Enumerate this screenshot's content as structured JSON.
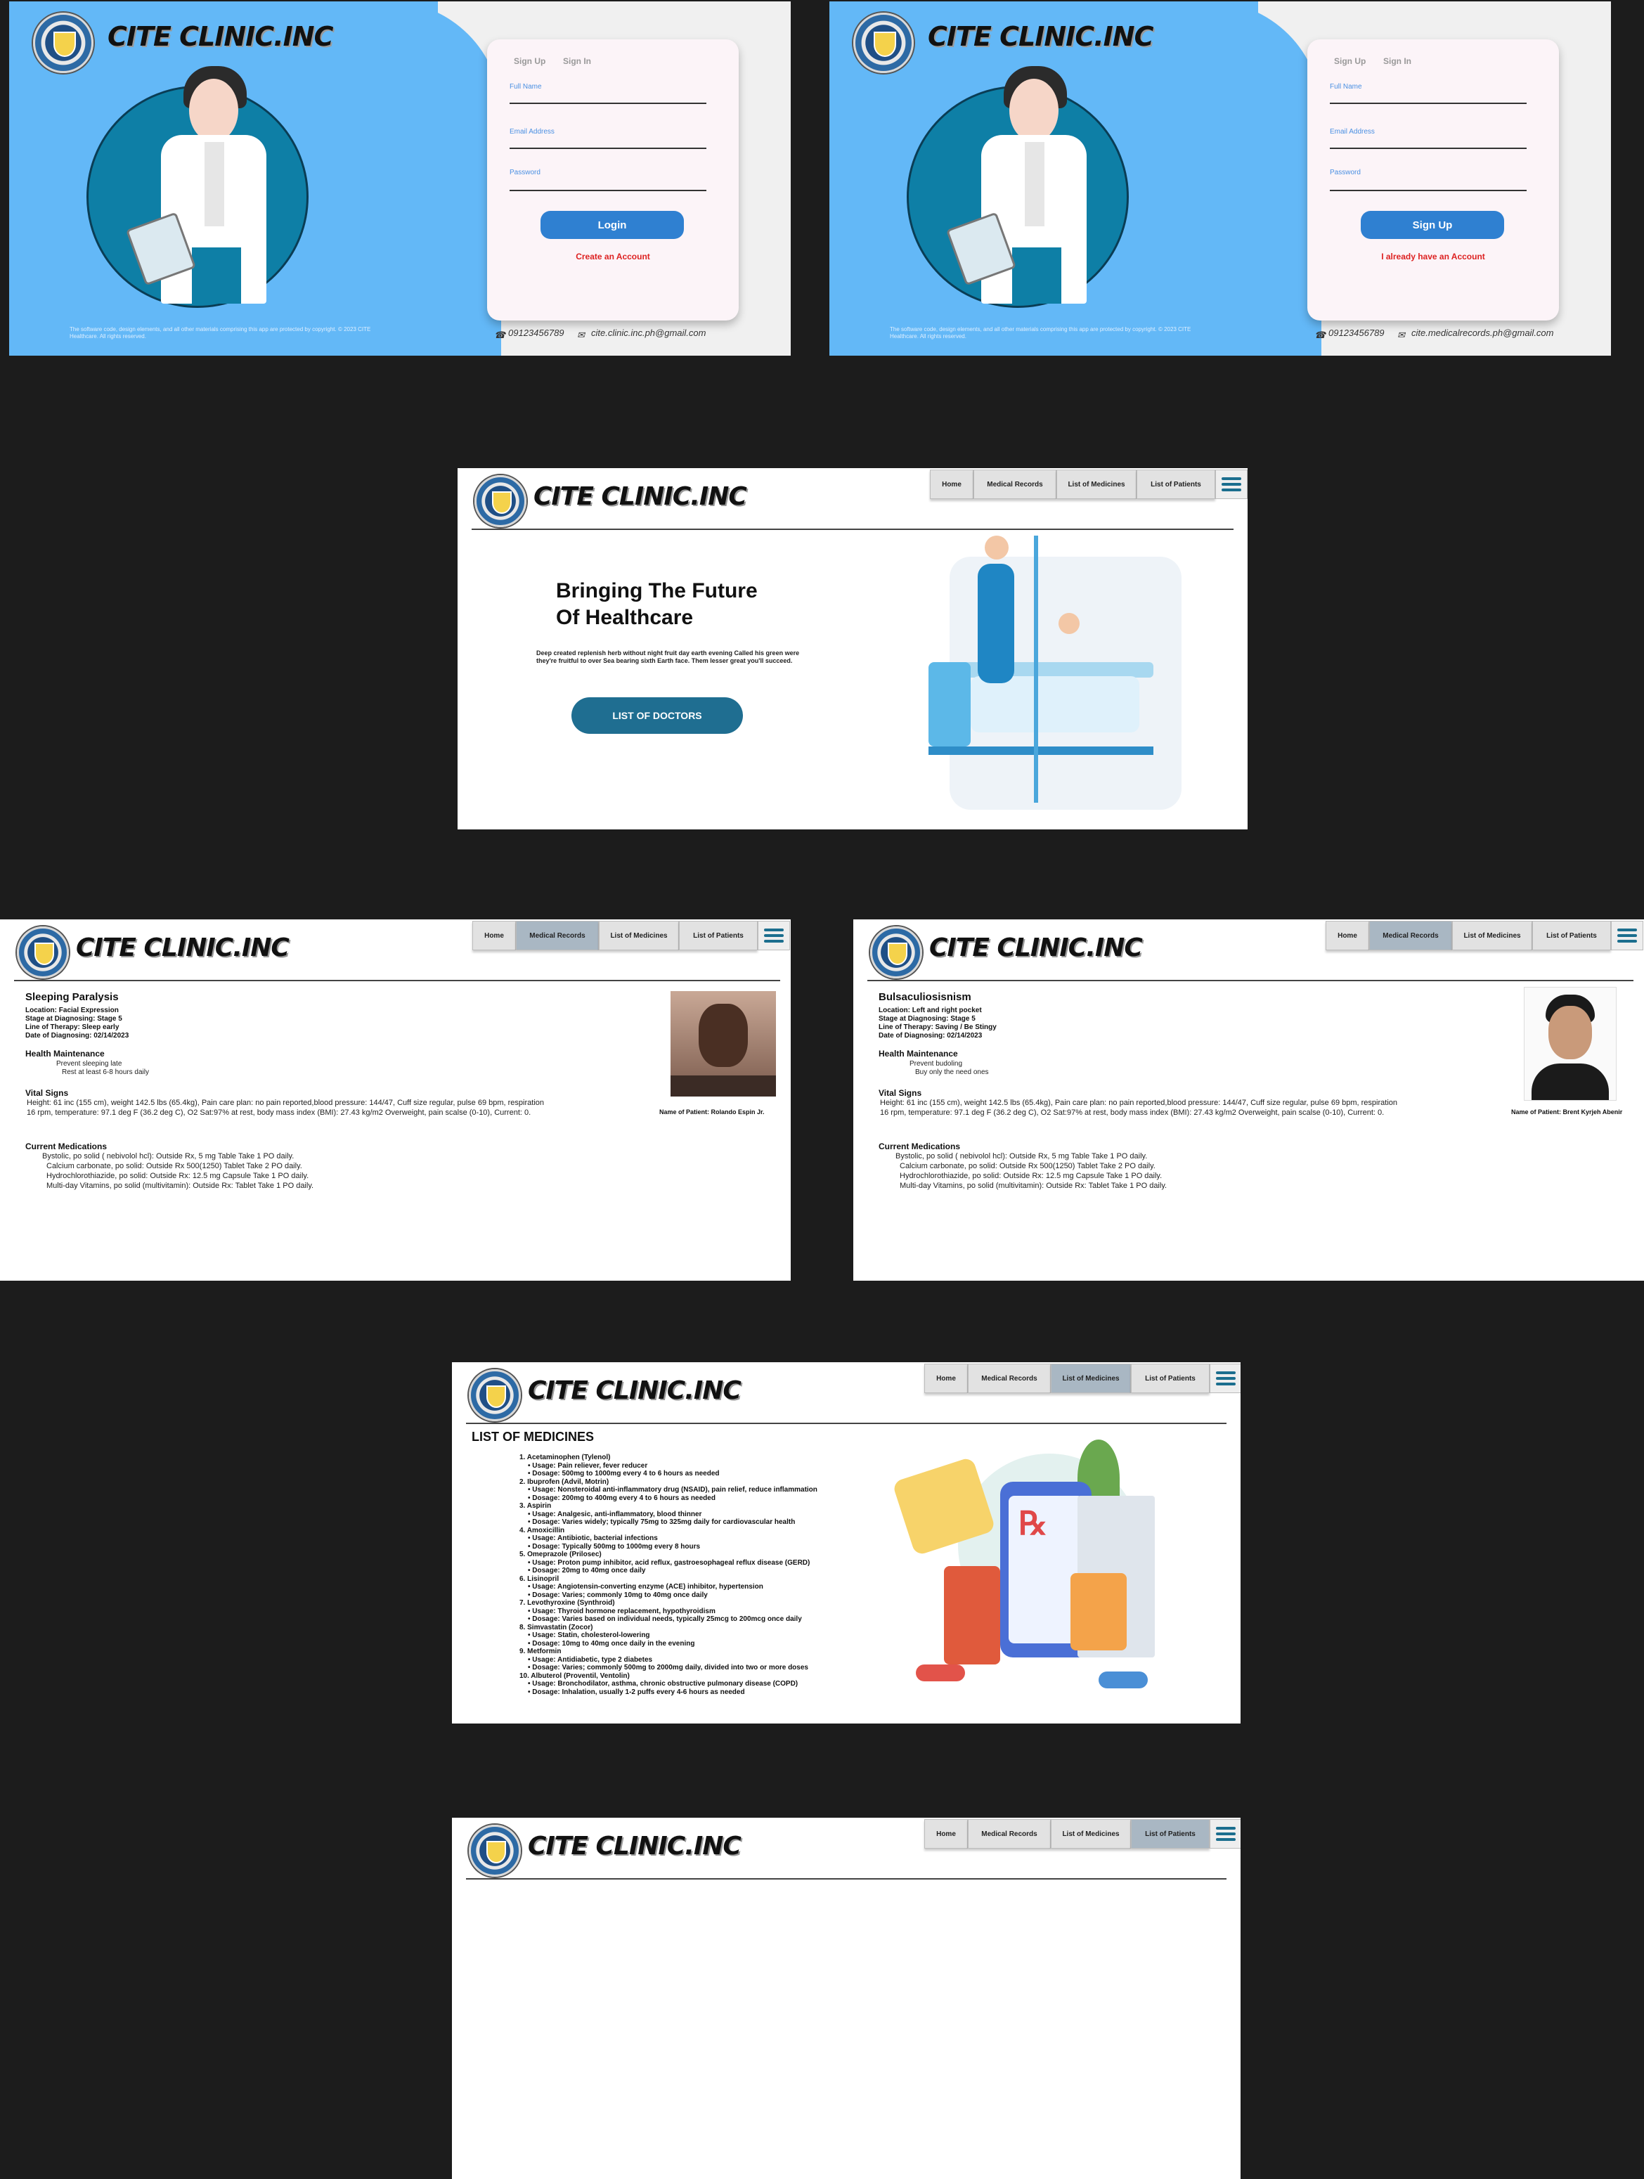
{
  "brand": "CITE CLINIC.INC",
  "nav": {
    "home": "Home",
    "records": "Medical Records",
    "medicines": "List of Medicines",
    "patients": "List of Patients"
  },
  "login1": {
    "tab_signup": "Sign Up",
    "tab_signin": "Sign In",
    "full_name": "Full Name",
    "email": "Email Address",
    "password": "Password",
    "button": "Login",
    "link": "Create an Account",
    "copyright": "The software code, design elements, and all other materials comprising this app are protected by copyright. © 2023 CITE Healthcare. All rights reserved.",
    "phone": "09123456789",
    "mail": "cite.clinic.inc.ph@gmail.com"
  },
  "login2": {
    "tab_signup": "Sign Up",
    "tab_signin": "Sign In",
    "full_name": "Full Name",
    "email": "Email Address",
    "password": "Password",
    "button": "Sign Up",
    "link": "I already have an Account",
    "copyright": "The software code, design elements, and all other materials comprising this app are protected by copyright. © 2023 CITE Healthcare. All rights reserved.",
    "phone": "09123456789",
    "mail": "cite.medicalrecords.ph@gmail.com"
  },
  "home": {
    "headline1": "Bringing The Future",
    "headline2": "Of Healthcare",
    "body": "Deep created replenish herb without night fruit day earth evening Called his green were they're fruitful to over Sea bearing sixth Earth face. Them lesser great you'll succeed.",
    "button": "LIST OF DOCTORS"
  },
  "record1": {
    "title": "Sleeping Paralysis",
    "location": "Location: Facial Expression",
    "stage": "Stage at Diagnosing: Stage 5",
    "therapy": "Line of Therapy: Sleep early",
    "date": "Date of Diagnosing: 02/14/2023",
    "hm_title": "Health Maintenance",
    "hm1": "Prevent sleeping late",
    "hm2": "Rest at least 6-8 hours daily",
    "vs_title": "Vital Signs",
    "vs1": "Height: 61 inc (155 cm), weight 142.5 lbs (65.4kg), Pain care plan: no pain reported,blood pressure: 144/47, Cuff size regular, pulse 69 bpm, respiration",
    "vs2": "16 rpm, temperature: 97.1 deg F (36.2 deg C), O2 Sat:97% at rest, body mass index (BMI): 27.43 kg/m2 Overweight, pain scalse (0-10), Current: 0.",
    "cm_title": "Current Medications",
    "cm1": "Bystolic, po solid ( nebivolol hcl): Outside Rx, 5 mg Table Take 1 PO daily.",
    "cm2": "Calcium carbonate, po solid: Outside Rx 500(1250) Tablet Take 2 PO daily.",
    "cm3": "Hydrochlorothiazide, po solid: Outside Rx: 12.5 mg Capsule Take 1 PO daily.",
    "cm4": "Multi-day Vitamins, po solid (multivitamin): Outside Rx: Tablet Take 1 PO daily.",
    "patient": "Name of Patient: Rolando Espin Jr."
  },
  "record2": {
    "title": "Bulsaculiosisnism",
    "location": "Location: Left and right pocket",
    "stage": "Stage at Diagnosing: Stage 5",
    "therapy": "Line of Therapy: Saving / Be Stingy",
    "date": "Date of Diagnosing: 02/14/2023",
    "hm_title": "Health Maintenance",
    "hm1": "Prevent budoling",
    "hm2": "Buy only the need ones",
    "vs_title": "Vital Signs",
    "vs1": "Height: 61 inc (155 cm), weight 142.5 lbs (65.4kg), Pain care plan: no pain reported,blood pressure: 144/47, Cuff size regular, pulse 69 bpm, respiration",
    "vs2": "16 rpm, temperature: 97.1 deg F (36.2 deg C), O2 Sat:97% at rest, body mass index (BMI): 27.43 kg/m2 Overweight, pain scalse (0-10), Current: 0.",
    "cm_title": "Current Medications",
    "cm1": "Bystolic, po solid ( nebivolol hcl): Outside Rx, 5 mg Table Take 1 PO daily.",
    "cm2": "Calcium carbonate, po solid: Outside Rx 500(1250) Tablet Take 2 PO daily.",
    "cm3": "Hydrochlorothiazide, po solid: Outside Rx: 12.5 mg Capsule Take 1 PO daily.",
    "cm4": "Multi-day Vitamins, po solid (multivitamin): Outside Rx: Tablet Take 1 PO daily.",
    "patient": "Name of Patient: Brent Kyrjeh Abenir"
  },
  "medicines": {
    "title": "LIST OF MEDICINES",
    "lines": [
      "1. Acetaminophen (Tylenol)",
      "• Usage: Pain reliever, fever reducer",
      "• Dosage: 500mg to 1000mg every 4 to 6 hours as needed",
      "2. Ibuprofen (Advil, Motrin)",
      "• Usage: Nonsteroidal anti-inflammatory drug (NSAID), pain relief, reduce inflammation",
      "• Dosage: 200mg to 400mg every 4 to 6 hours as needed",
      "3. Aspirin",
      "• Usage: Analgesic, anti-inflammatory, blood thinner",
      "• Dosage: Varies widely; typically 75mg to 325mg daily for cardiovascular health",
      "4. Amoxicillin",
      "• Usage: Antibiotic, bacterial infections",
      "• Dosage: Typically 500mg to 1000mg every 8 hours",
      "5. Omeprazole (Prilosec)",
      "• Usage: Proton pump inhibitor, acid reflux, gastroesophageal reflux disease (GERD)",
      "• Dosage: 20mg to 40mg once daily",
      "6. Lisinopril",
      "• Usage: Angiotensin-converting enzyme (ACE) inhibitor, hypertension",
      "• Dosage: Varies; commonly 10mg to 40mg once daily",
      "7. Levothyroxine (Synthroid)",
      "• Usage: Thyroid hormone replacement, hypothyroidism",
      "• Dosage: Varies based on individual needs, typically 25mcg to 200mcg once daily",
      "8. Simvastatin (Zocor)",
      "• Usage: Statin, cholesterol-lowering",
      "• Dosage: 10mg to 40mg once daily in the evening",
      "9. Metformin",
      "• Usage: Antidiabetic, type 2 diabetes",
      "• Dosage: Varies; commonly 500mg to 2000mg daily, divided into two or more doses",
      "10. Albuterol (Proventil, Ventolin)",
      "• Usage: Bronchodilator, asthma, chronic obstructive pulmonary disease (COPD)",
      "• Dosage: Inhalation, usually 1-2 puffs every 4-6 hours as needed"
    ]
  },
  "colors": {
    "sky": "#63b8f7",
    "teal": "#1f6e91",
    "accent_blue": "#2f80d1",
    "link_red": "#dd2222"
  }
}
